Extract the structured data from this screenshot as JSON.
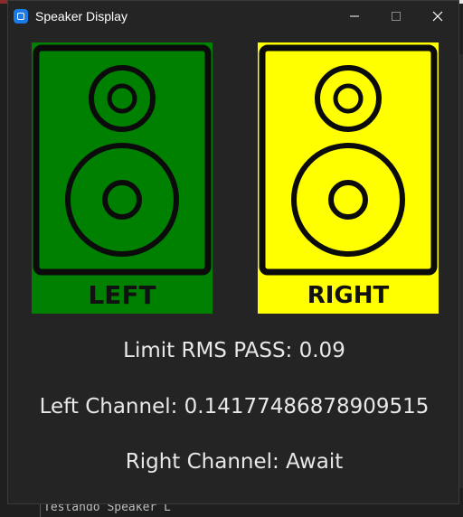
{
  "background": {
    "terminal_text": "Testando Speaker L"
  },
  "window": {
    "title": "Speaker Display",
    "controls": {
      "minimize": "minimize",
      "maximize": "maximize",
      "close": "close"
    }
  },
  "speakers": {
    "left": {
      "label": "LEFT",
      "color": "#008000"
    },
    "right": {
      "label": "RIGHT",
      "color": "#ffff00"
    }
  },
  "info": {
    "limit": "Limit RMS PASS: 0.09",
    "left_channel": "Left Channel: 0.14177486878909515",
    "right_channel": "Right Channel: Await"
  }
}
